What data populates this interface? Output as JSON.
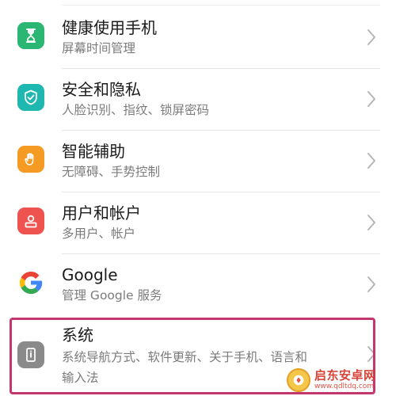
{
  "settings_items": [
    {
      "title": "健康使用手机",
      "subtitle": "屏幕时间管理",
      "icon": "hourglass-icon",
      "icon_color": "#2bb673"
    },
    {
      "title": "安全和隐私",
      "subtitle": "人脸识别、指纹、锁屏密码",
      "icon": "shield-check-icon",
      "icon_color": "#1fb8b0"
    },
    {
      "title": "智能辅助",
      "subtitle": "无障碍、手势控制",
      "icon": "hand-icon",
      "icon_color": "#f59a23"
    },
    {
      "title": "用户和帐户",
      "subtitle": "多用户、帐户",
      "icon": "user-icon",
      "icon_color": "#ef5350"
    },
    {
      "title": "Google",
      "subtitle": "管理 Google 服务",
      "icon": "google-icon",
      "icon_color": "#ffffff"
    },
    {
      "title": "系统",
      "subtitle": "系统导航方式、软件更新、关于手机、语言和",
      "subtitle_line2": "输入法",
      "icon": "phone-info-icon",
      "icon_color": "#8a8a8a"
    }
  ],
  "highlight_color": "#c2386e",
  "watermark": {
    "name": "启东安卓网",
    "url": "www.qdltdq.com"
  }
}
